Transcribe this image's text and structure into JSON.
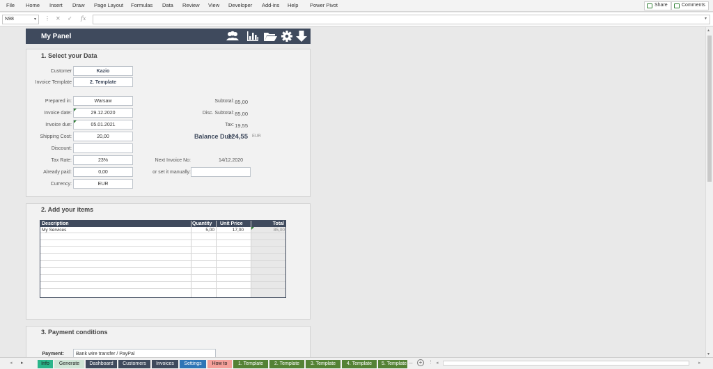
{
  "ribbon": {
    "menu": [
      "File",
      "Home",
      "Insert",
      "Draw",
      "Page Layout",
      "Formulas",
      "Data",
      "Review",
      "View",
      "Developer",
      "Add-ins",
      "Help",
      "Power Pivot"
    ],
    "share_label": "Share",
    "comments_label": "Comments"
  },
  "formula_bar": {
    "name_box": "N98",
    "fx": "fx",
    "value": ""
  },
  "panel": {
    "title": "My Panel"
  },
  "section1": {
    "title": "1. Select your Data",
    "customer_label": "Customer",
    "customer_value": "Kazio",
    "template_label": "Invoice Template",
    "template_value": "2. Template",
    "prepared_label": "Prepared in:",
    "prepared_value": "Warsaw",
    "date_label": "Invoice date:",
    "date_value": "29.12.2020",
    "due_label": "Invoice due:",
    "due_value": "05.01.2021",
    "shipping_label": "Shipping Cost:",
    "shipping_value": "20,00",
    "discount_label": "Discount:",
    "discount_value": "",
    "taxrate_label": "Tax Rate:",
    "taxrate_value": "23%",
    "paid_label": "Already paid:",
    "paid_value": "0,00",
    "currency_label": "Currency:",
    "currency_value": "EUR",
    "subtotal_label": "Subtotal:",
    "subtotal_value": "85,00",
    "disc_subtotal_label": "Disc. Subtotal:",
    "disc_subtotal_value": "85,00",
    "tax_label": "Tax:",
    "tax_value": "19,55",
    "balance_label": "Balance Due:",
    "balance_value": "124,55",
    "balance_currency": "EUR",
    "next_invoice_label": "Next Invoice No:",
    "next_invoice_value": "14/12.2020",
    "manual_label": "or set it manually:",
    "manual_value": ""
  },
  "section2": {
    "title": "2. Add your items",
    "headers": [
      "Description",
      "Quantity",
      "Unit Price",
      "Total"
    ],
    "rows": [
      [
        "My Services",
        "5,00",
        "17,00",
        "85,00"
      ]
    ]
  },
  "section3": {
    "title": "3. Payment conditions",
    "payment_label": "Payment:",
    "payment_value": "Bank wire transfer / PayPal"
  },
  "tabs": [
    {
      "label": "Info",
      "bg": "#2bb58a",
      "fg": "#1a1a1a"
    },
    {
      "label": "Generate",
      "bg": "#cfe5d6",
      "fg": "#1a1a1a"
    },
    {
      "label": "Dashboard",
      "bg": "#3f4a5d",
      "fg": "#ffffff"
    },
    {
      "label": "Customers",
      "bg": "#3f4a5d",
      "fg": "#ffffff"
    },
    {
      "label": "Invoices",
      "bg": "#3f4a5d",
      "fg": "#ffffff"
    },
    {
      "label": "Settings",
      "bg": "#2e75b6",
      "fg": "#ffffff"
    },
    {
      "label": "How to",
      "bg": "#f4a09a",
      "fg": "#1a1a1a"
    },
    {
      "label": "1. Template",
      "bg": "#548235",
      "fg": "#ffffff"
    },
    {
      "label": "2. Template",
      "bg": "#548235",
      "fg": "#ffffff"
    },
    {
      "label": "3. Template",
      "bg": "#548235",
      "fg": "#ffffff"
    },
    {
      "label": "4. Template",
      "bg": "#548235",
      "fg": "#ffffff"
    },
    {
      "label": "5. Template",
      "bg": "#548235",
      "fg": "#ffffff"
    }
  ],
  "tabs_more": "...",
  "colors": {
    "header": "#3f4a5d",
    "accent_green": "#2e7d32"
  }
}
